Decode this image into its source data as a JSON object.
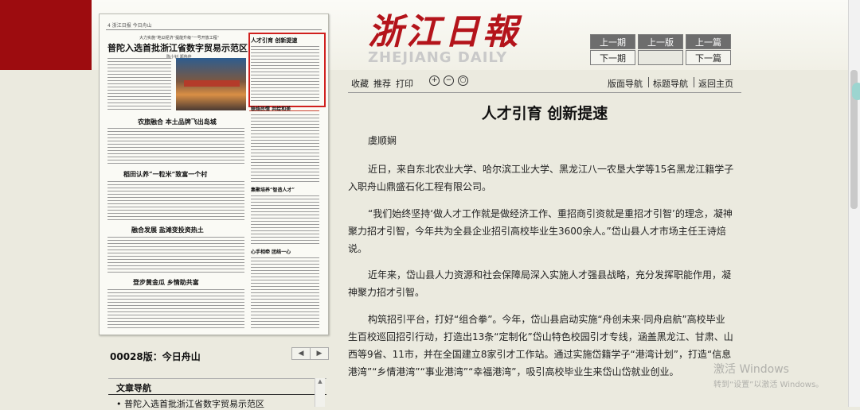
{
  "masthead": {
    "chinese": "浙江日報",
    "english": "ZHEJIANG DAILY"
  },
  "pager": {
    "prev_issue": "上一期",
    "next_issue": "下一期",
    "prev_page": "上一版",
    "prev_article": "上一篇",
    "next_article": "下一篇"
  },
  "paper": {
    "header": "4 浙江日报  今日舟山",
    "subhead": "大力实施“地瓜经济”提能升级“一号开放工程”",
    "headline_main": "普陀入选首批浙江省数字贸易示范区",
    "headline_main_byline": "陈小钊  郑伟佳",
    "highlighted_article": "人才引育  创新提速",
    "headline_2": "农旅融合  本土品牌飞出岛城",
    "headline_3": "稻田认养“一粒米”致富一个村",
    "headline_4": "融合发展  盐滩变投资热土",
    "headline_5": "登步黄金瓜  乡情助共富",
    "side_1": "联络民情  共绘和美",
    "side_2": "集聚培养“智造人才”",
    "side_3": "心手相牵  团结一心"
  },
  "page_label": "00028版：今日舟山",
  "page_nav": {
    "prev": "◀",
    "next": "▶"
  },
  "toc": {
    "heading": "文章导航",
    "items": [
      "普陀入选首批浙江省数字贸易示范区"
    ],
    "scroll_up": "▲"
  },
  "toolbar": {
    "favorite": "收藏",
    "recommend": "推荐",
    "print": "打印",
    "zoom_in": "+",
    "zoom_out": "−",
    "zoom_reset": "○",
    "page_nav": "版面导航",
    "title_nav": "标题导航",
    "home": "返回主页"
  },
  "article": {
    "title": "人才引育  创新提速",
    "author": "虞顺娴",
    "paragraphs": [
      "近日，来自东北农业大学、哈尔滨工业大学、黑龙江八一农垦大学等15名黑龙江籍学子入职舟山鼎盛石化工程有限公司。",
      "“我们始终坚持‘做人才工作就是做经济工作、重招商引资就是重招才引智’的理念，凝神聚力招才引智，今年共为全县企业招引高校毕业生3600余人。”岱山县人才市场主任王诗焙说。",
      "近年来，岱山县人力资源和社会保障局深入实施人才强县战略，充分发挥职能作用，凝神聚力招才引智。",
      "构筑招引平台，打好“组合拳”。今年，岱山县启动实施“舟创未来·同舟启航”高校毕业生百校巡回招引行动，打造出13条“定制化”岱山特色校园引才专线，涵盖黑龙江、甘肃、山西等9省、11市，并在全国建立8家引才工作站。通过实施岱籍学子“港湾计划”，打造“信息港湾”“乡情港湾”“事业港湾”“幸福港湾”，吸引高校毕业生来岱山岱就业创业。"
    ]
  },
  "watermark": {
    "line1": "激活 Windows",
    "line2": "转到“设置”以激活 Windows。"
  },
  "colors": {
    "brand_red": "#9d0c0f",
    "highlight_red": "#d0201e",
    "page_bg": "#ebeadf"
  }
}
